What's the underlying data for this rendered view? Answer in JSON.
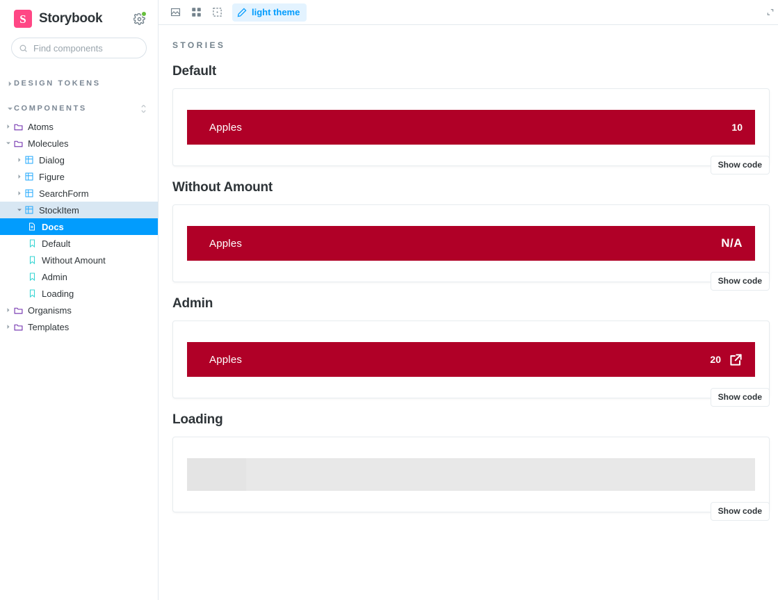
{
  "sidebar": {
    "brand": {
      "logo_letter": "S",
      "title": "Storybook"
    },
    "settings_icon_name": "gear-icon",
    "search": {
      "placeholder": "Find components",
      "value": "",
      "shortcut": "/"
    },
    "sections": [
      {
        "label": "DESIGN TOKENS",
        "expanded": false
      },
      {
        "label": "COMPONENTS",
        "expanded": true
      }
    ],
    "tree": [
      {
        "label": "Atoms",
        "icon": "folder-icon",
        "level": 1,
        "state": "collapsed"
      },
      {
        "label": "Molecules",
        "icon": "folder-icon",
        "level": 1,
        "state": "expanded"
      },
      {
        "label": "Dialog",
        "icon": "component-icon",
        "level": 2,
        "state": "collapsed"
      },
      {
        "label": "Figure",
        "icon": "component-icon",
        "level": 2,
        "state": "collapsed"
      },
      {
        "label": "SearchForm",
        "icon": "component-icon",
        "level": 2,
        "state": "collapsed"
      },
      {
        "label": "StockItem",
        "icon": "component-icon",
        "level": 2,
        "state": "expanded",
        "highlight": "soft"
      },
      {
        "label": "Docs",
        "icon": "document-icon",
        "level": 3,
        "state": "leaf",
        "highlight": "hard"
      },
      {
        "label": "Default",
        "icon": "story-icon",
        "level": 3,
        "state": "leaf"
      },
      {
        "label": "Without Amount",
        "icon": "story-icon",
        "level": 3,
        "state": "leaf"
      },
      {
        "label": "Admin",
        "icon": "story-icon",
        "level": 3,
        "state": "leaf"
      },
      {
        "label": "Loading",
        "icon": "story-icon",
        "level": 3,
        "state": "leaf"
      },
      {
        "label": "Organisms",
        "icon": "folder-icon",
        "level": 1,
        "state": "collapsed"
      },
      {
        "label": "Templates",
        "icon": "folder-icon",
        "level": 1,
        "state": "collapsed"
      }
    ]
  },
  "toolbar": {
    "buttons": [
      {
        "name": "backgrounds-icon",
        "title": "Backgrounds"
      },
      {
        "name": "grid-icon",
        "title": "Grid"
      },
      {
        "name": "measure-icon",
        "title": "Measure"
      }
    ],
    "theme_toggle": {
      "label": "light theme",
      "icon": "pencil-icon",
      "active": true
    },
    "right_icon": "expand-icon"
  },
  "doc": {
    "kicker": "STORIES",
    "show_code_label": "Show code",
    "stories": [
      {
        "title": "Default",
        "item": {
          "name": "Apples",
          "amount": "10",
          "amount_style": "number",
          "link": false,
          "loading": false
        }
      },
      {
        "title": "Without Amount",
        "item": {
          "name": "Apples",
          "amount": "N/A",
          "amount_style": "na",
          "link": false,
          "loading": false
        }
      },
      {
        "title": "Admin",
        "item": {
          "name": "Apples",
          "amount": "20",
          "amount_style": "number",
          "link": true,
          "link_icon": "external-link-icon",
          "loading": false
        }
      },
      {
        "title": "Loading",
        "item": {
          "name": "",
          "amount": "",
          "amount_style": "none",
          "link": false,
          "loading": true
        }
      }
    ]
  },
  "colors": {
    "brand_pink": "#FF4785",
    "accent_blue": "#029CFD",
    "stock_red": "#B00027",
    "selected_soft": "#D8E7F3",
    "text_dark": "#2E3438",
    "text_muted": "#73828C",
    "skeleton_gray": "#E8E8E8"
  }
}
